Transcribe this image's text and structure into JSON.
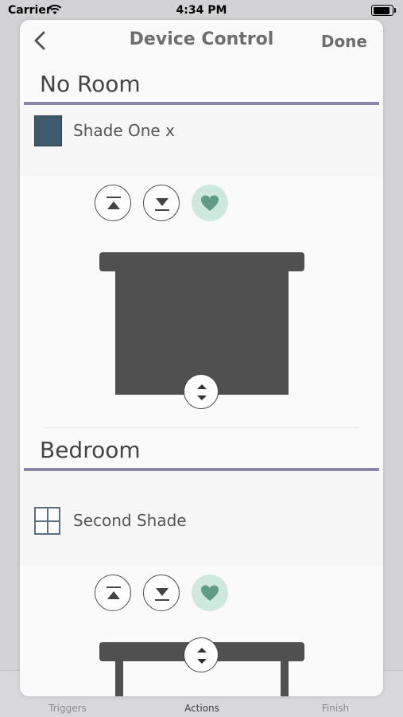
{
  "status": {
    "carrier": "Carrier",
    "time": "4:34 PM"
  },
  "nav": {
    "title": "Device Control",
    "done_label": "Done"
  },
  "rooms": [
    {
      "name": "No Room",
      "device": {
        "name": "Shade One x",
        "icon": "shade-solid-icon"
      }
    },
    {
      "name": "Bedroom",
      "device": {
        "name": "Second Shade",
        "icon": "window-icon"
      }
    }
  ],
  "tabs": [
    {
      "label": "Triggers"
    },
    {
      "label": "Actions"
    },
    {
      "label": "Finish"
    }
  ],
  "colors": {
    "accent_line": "#8a86a8",
    "shade": "#505050",
    "favorite_bg": "#cfe8dd",
    "favorite_icon": "#5f9b86"
  }
}
